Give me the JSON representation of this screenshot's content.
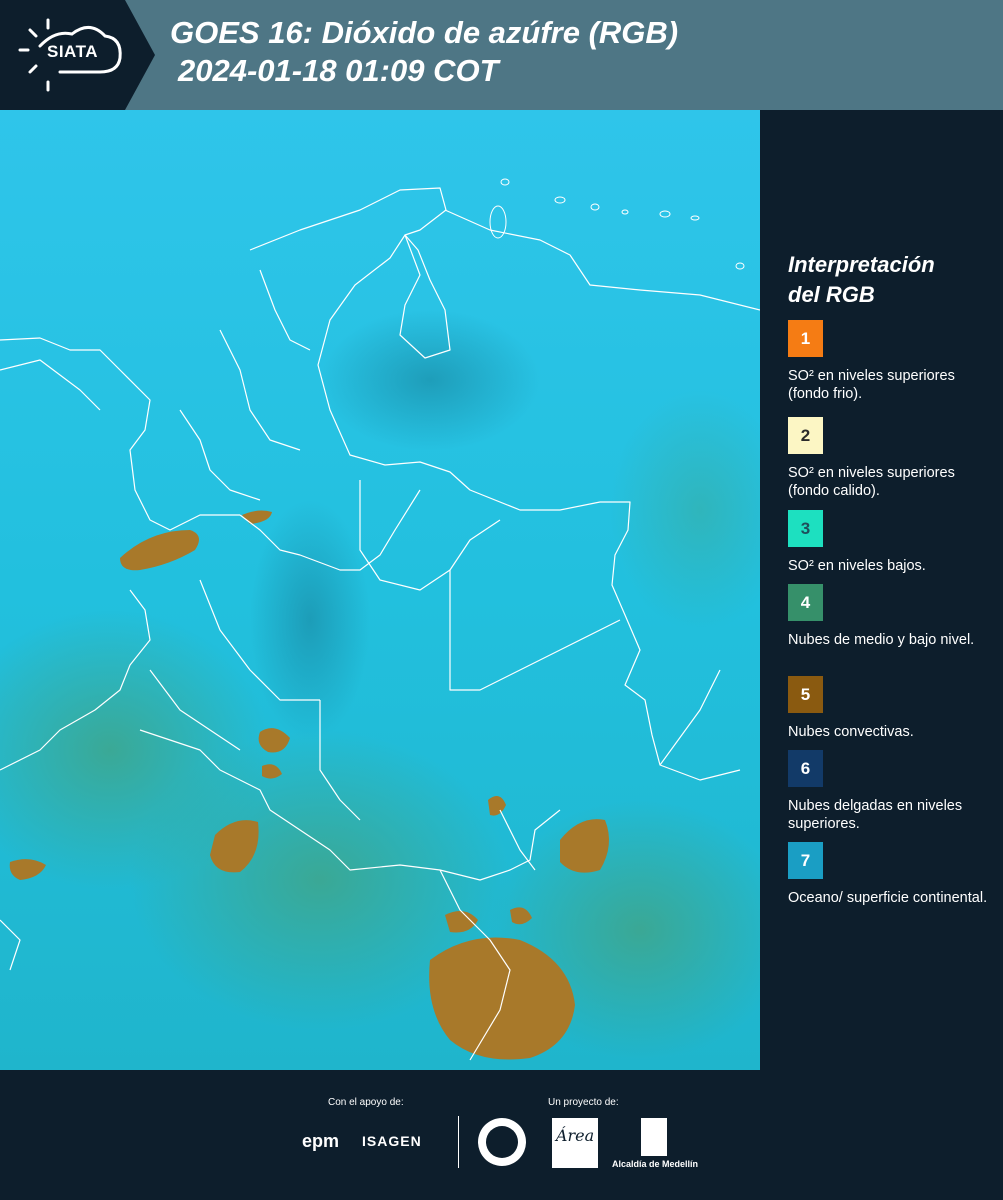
{
  "header": {
    "logo_text": "SIATA",
    "title_line1": "GOES 16: Dióxido de azúfre (RGB)",
    "title_line2": "2024-01-18 01:09 COT"
  },
  "legend": {
    "title_line1": "Interpretación",
    "title_line2": "del RGB",
    "items": [
      {
        "num": "1",
        "color": "#f57c14",
        "text_color": "#ffffff",
        "desc": "SO² en niveles superiores (fondo frio)."
      },
      {
        "num": "2",
        "color": "#fcf6c4",
        "text_color": "#2b2b2b",
        "desc": "SO² en niveles superiores (fondo calido)."
      },
      {
        "num": "3",
        "color": "#1de0c0",
        "text_color": "#1f4f5c",
        "desc": "SO² en niveles bajos."
      },
      {
        "num": "4",
        "color": "#36906a",
        "text_color": "#ffffff",
        "desc": "Nubes de medio y bajo nivel."
      },
      {
        "num": "5",
        "color": "#8a5a10",
        "text_color": "#ffffff",
        "desc": "Nubes convectivas."
      },
      {
        "num": "6",
        "color": "#123a68",
        "text_color": "#ffffff",
        "desc": "Nubes delgadas en niveles superiores."
      },
      {
        "num": "7",
        "color": "#1a9ec4",
        "text_color": "#ffffff",
        "desc": "Oceano/ superficie continental."
      }
    ]
  },
  "footer": {
    "support_label": "Con el apoyo de:",
    "project_label": "Un proyecto de:",
    "sponsor1": "epm",
    "sponsor2": "ISAGEN",
    "area_mark": "Área",
    "alcaldia": "Alcaldía de Medellín"
  },
  "map": {
    "ocean_color": "#22c3e3",
    "land_color": "#2ab0c8",
    "convective_color": "#a87a26",
    "border_color": "#ffffff"
  }
}
